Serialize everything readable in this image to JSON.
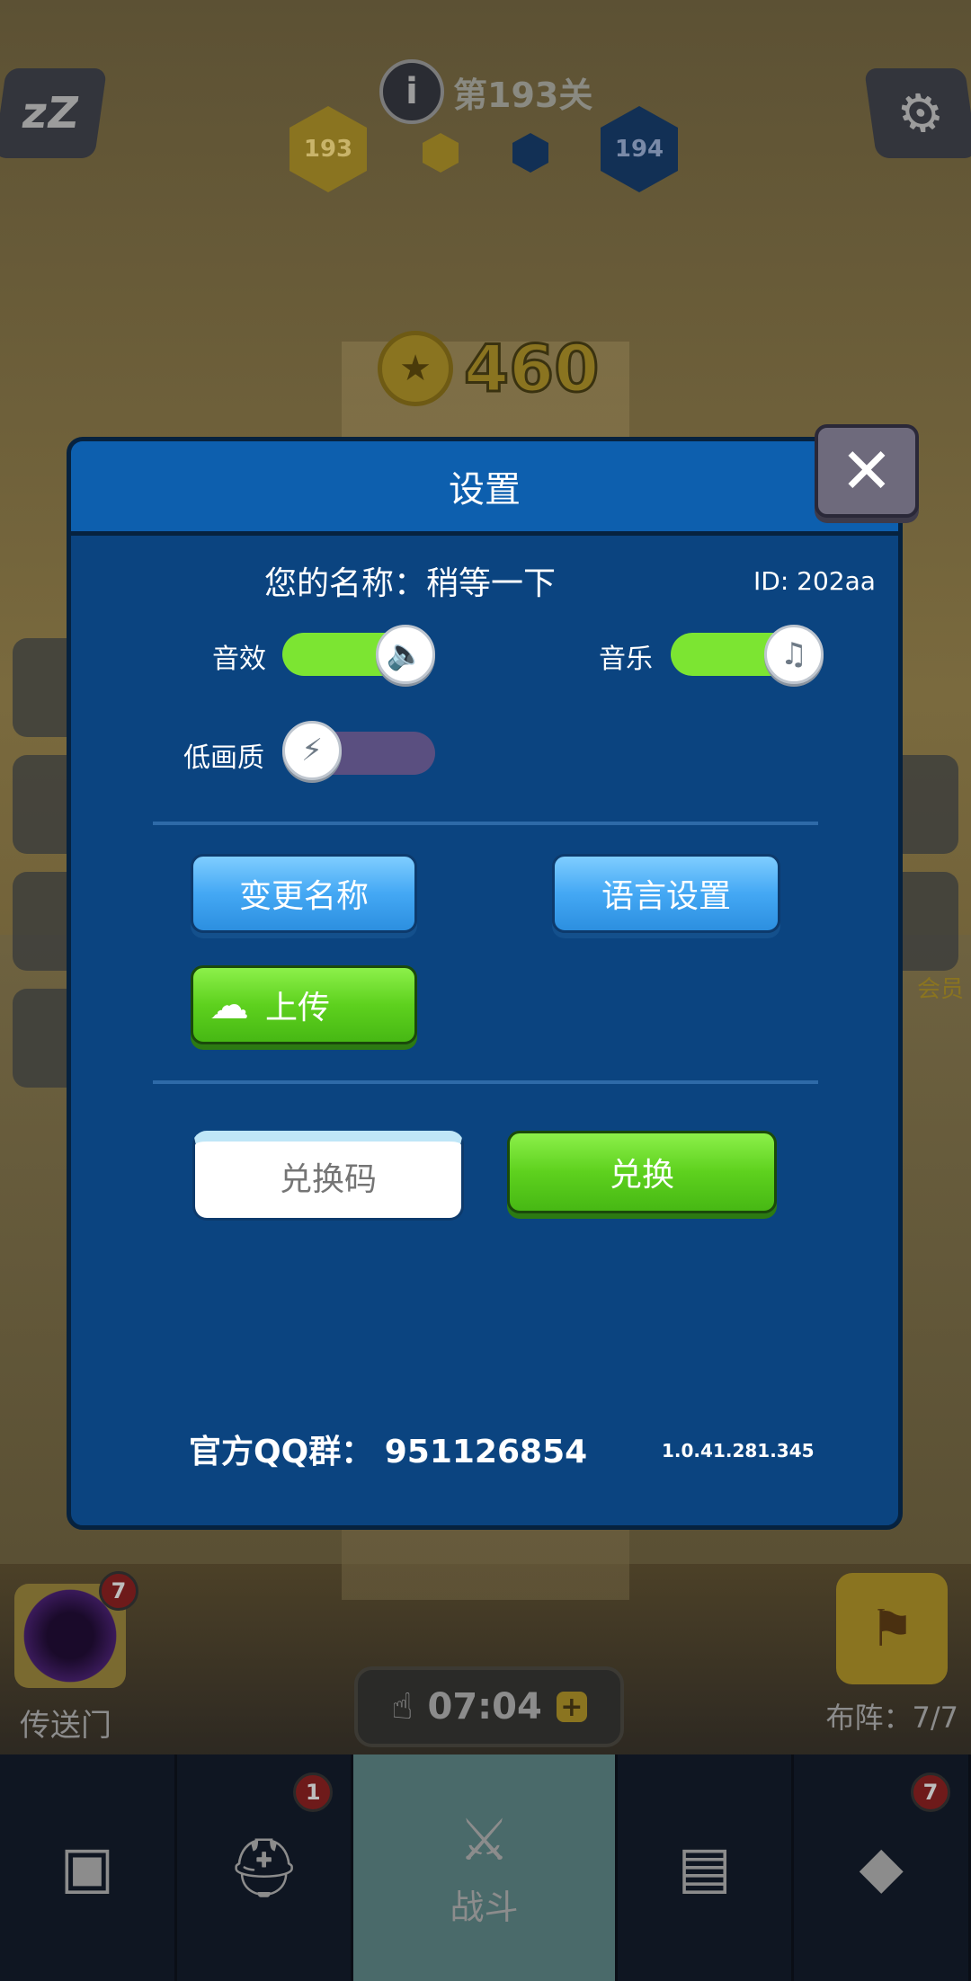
{
  "hud": {
    "level_text": "第193关",
    "current_level": "193",
    "next_level": "194",
    "coins": "460",
    "sleep_icon_text": "zZ",
    "vip_label": "会员"
  },
  "portal": {
    "label": "传送门",
    "badge": "7"
  },
  "formation": {
    "label": "布阵：7/7"
  },
  "timer": {
    "value": "07:04"
  },
  "bottom_nav": {
    "tabs": [
      {
        "icon": "treasure-chest-icon",
        "label": "",
        "badge": ""
      },
      {
        "icon": "viking-helmet-icon",
        "label": "",
        "badge": "1"
      },
      {
        "icon": "crossed-swords-icon",
        "label": "战斗",
        "badge": ""
      },
      {
        "icon": "spell-book-icon",
        "label": "",
        "badge": ""
      },
      {
        "icon": "amulet-icon",
        "label": "",
        "badge": "7"
      }
    ]
  },
  "settings": {
    "title": "设置",
    "name_label": "您的名称：稍等一下",
    "id_label": "ID:  202aa",
    "sound_label": "音效",
    "music_label": "音乐",
    "low_quality_label": "低画质",
    "sound_on": true,
    "music_on": true,
    "low_quality_on": false,
    "change_name": "变更名称",
    "language": "语言设置",
    "upload": "上传",
    "code_placeholder": "兑换码",
    "redeem": "兑换",
    "qq_group": "官方QQ群：  951126854",
    "version": "1.0.41.281.345"
  },
  "colors": {
    "dialog_bg": "#0b4480",
    "header_bg": "#0d5fae",
    "toggle_on": "#7ce532",
    "toggle_off": "#5a4f80",
    "button_blue": "#44a8f4",
    "button_green": "#5ed11e"
  }
}
